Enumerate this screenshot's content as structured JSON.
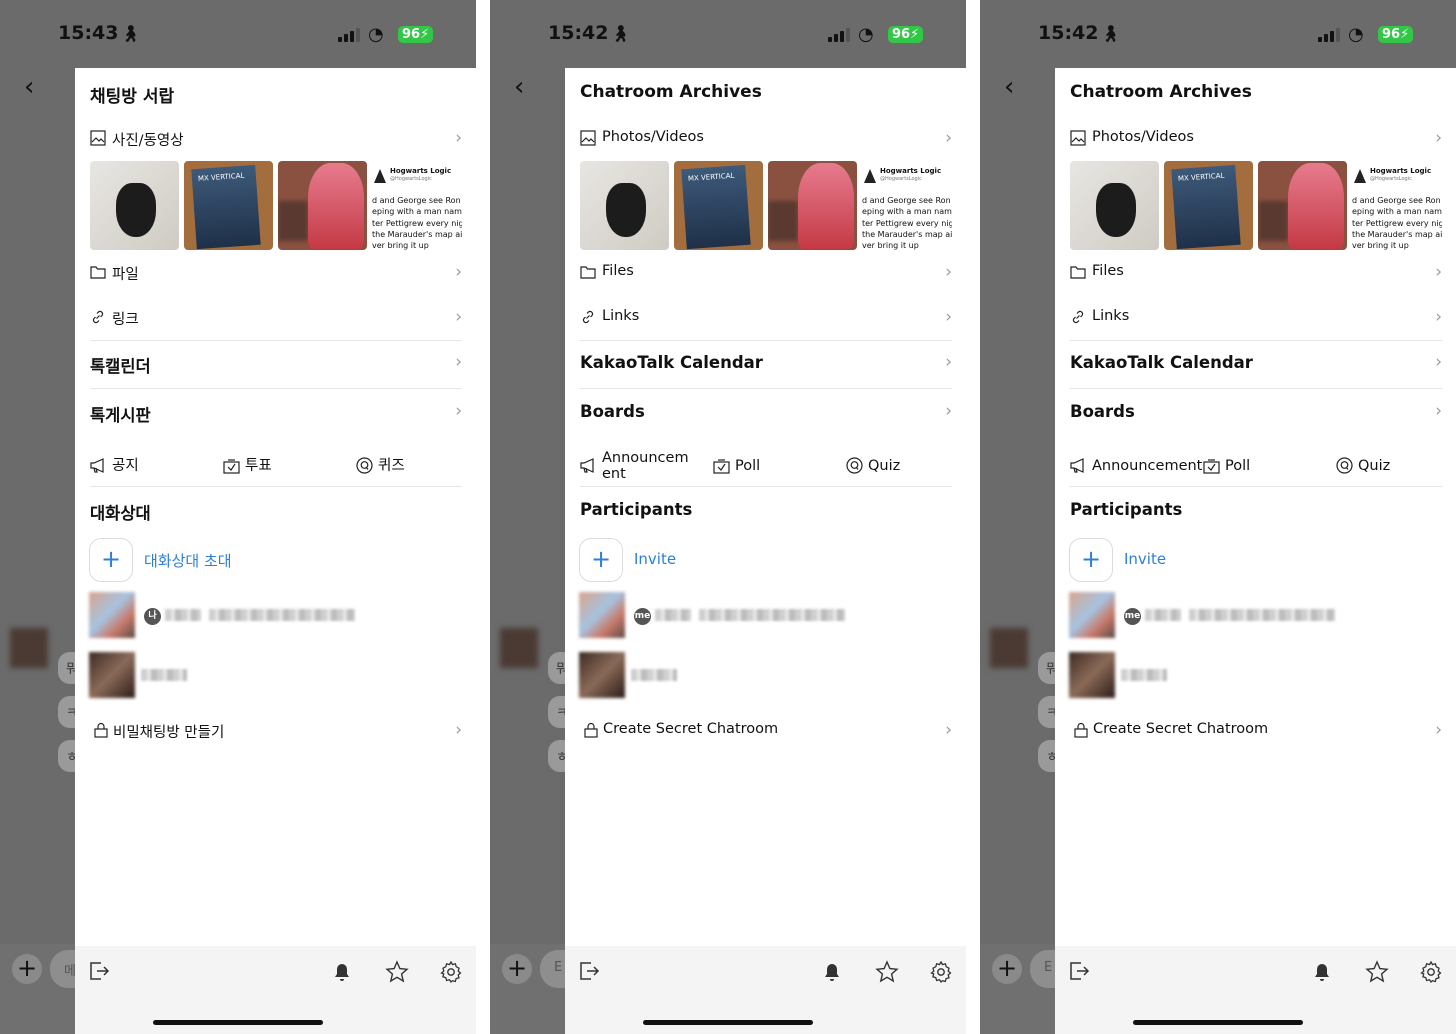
{
  "screens": [
    {
      "status": {
        "time": "15:43",
        "battery": "96"
      },
      "panel_title": "채팅방 서랍",
      "media_label": "사진/동영상",
      "files_label": "파일",
      "links_label": "링크",
      "calendar_label": "톡캘린더",
      "boards_label": "톡게시판",
      "announcement_label": "공지",
      "poll_label": "투표",
      "quiz_label": "퀴즈",
      "participants_label": "대화상대",
      "invite_label": "대화상대 초대",
      "me_badge": "나",
      "secret_label": "비밀채팅방 만들기",
      "side_letters": [
        "뭐",
        "ㅋ",
        "ㅎ"
      ],
      "input_stub": "메"
    },
    {
      "status": {
        "time": "15:42",
        "battery": "96"
      },
      "panel_title": "Chatroom Archives",
      "media_label": "Photos/Videos",
      "files_label": "Files",
      "links_label": "Links",
      "calendar_label": "KakaoTalk Calendar",
      "boards_label": "Boards",
      "announcement_label": "Announcem ent",
      "poll_label": "Poll",
      "quiz_label": "Quiz",
      "participants_label": "Participants",
      "invite_label": "Invite",
      "me_badge": "me",
      "secret_label": "Create Secret Chatroom",
      "side_letters": [
        "뭐",
        "ㅋ",
        "ㅎ"
      ],
      "input_stub": "E"
    },
    {
      "status": {
        "time": "15:42",
        "battery": "96"
      },
      "panel_title": "Chatroom Archives",
      "media_label": "Photos/Videos",
      "files_label": "Files",
      "links_label": "Links",
      "calendar_label": "KakaoTalk Calendar",
      "boards_label": "Boards",
      "announcement_label": "Announcement",
      "poll_label": "Poll",
      "quiz_label": "Quiz",
      "participants_label": "Participants",
      "invite_label": "Invite",
      "me_badge": "me",
      "secret_label": "Create Secret Chatroom",
      "side_letters": [
        "뭐",
        "ㅋ",
        "ㅎ"
      ],
      "input_stub": "E"
    }
  ],
  "thumb_text": {
    "box_label": "MX VERTICAL",
    "tweet_name": "Hogwarts Logic",
    "tweet_handle": "@HogwartsLogic",
    "tweet_lines": [
      "d and George see Ron",
      "eping with a man name",
      "ter Pettigrew every nigh",
      " the Marauder's map ai",
      "ver bring it up"
    ]
  },
  "colors": {
    "accent_blue": "#2c7fd9",
    "battery_green": "#33c748",
    "overlay": "#6e6e6e"
  }
}
